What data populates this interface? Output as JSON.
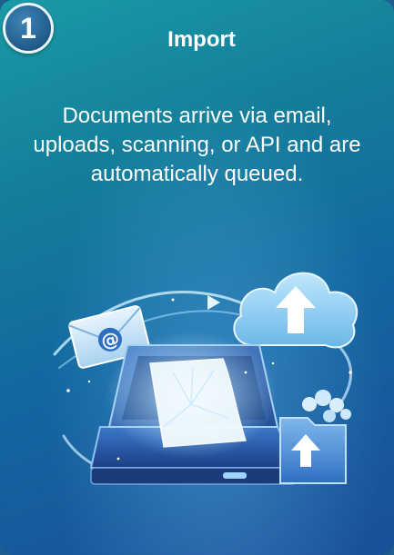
{
  "card": {
    "step_number": "1",
    "title": "Import",
    "description": "Documents arrive via email, uploads, scanning, or API and are automatically queued."
  },
  "illustration": {
    "icons": [
      "envelope-icon",
      "at-sign-icon",
      "cloud-upload-icon",
      "upload-arrow-icon",
      "scanner-icon",
      "document-icon",
      "folder-upload-icon"
    ],
    "email_symbol": "@"
  },
  "colors": {
    "background_top": "#1a9aa6",
    "background_bottom": "#1a4f96",
    "badge": "#1f5a8a",
    "text": "#ffffff"
  }
}
